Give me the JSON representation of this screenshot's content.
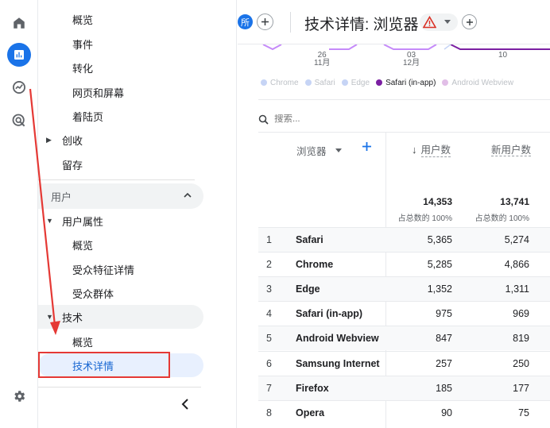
{
  "rail": {
    "items": [
      {
        "icon": "home-icon"
      },
      {
        "icon": "reports-icon",
        "active": true
      },
      {
        "icon": "explore-icon"
      },
      {
        "icon": "advertising-icon"
      }
    ],
    "settings_icon": "gear-icon"
  },
  "sidebar": {
    "top_items": [
      "概览",
      "事件",
      "转化",
      "网页和屏幕",
      "着陆页"
    ],
    "monetization": "创收",
    "retention": "留存",
    "section_user": "用户",
    "user_attributes": "用户属性",
    "user_attr_items": [
      "概览",
      "受众特征详情",
      "受众群体"
    ],
    "tech": "技术",
    "tech_items": [
      "概览",
      "技术详情"
    ],
    "collapse_icon": "chevron-left-icon"
  },
  "header": {
    "badge": "所",
    "title": "技术详情: 浏览器"
  },
  "chart": {
    "x_ticks": [
      {
        "day": "26",
        "month": "11月"
      },
      {
        "day": "03",
        "month": "12月"
      },
      {
        "day": "10",
        "month": ""
      }
    ],
    "legend": [
      {
        "label": "Chrome",
        "color": "#c6d4f5"
      },
      {
        "label": "Safari",
        "color": "#c6d4f5"
      },
      {
        "label": "Edge",
        "color": "#c6d4f5"
      },
      {
        "label": "Safari (in-app)",
        "color": "#7b1fa2"
      },
      {
        "label": "Android Webview",
        "color": "#e1bee7"
      }
    ]
  },
  "search": {
    "placeholder": "搜索..."
  },
  "table": {
    "dimension_header": "浏览器",
    "col_users": "用户数",
    "col_new_users": "新用户数",
    "total_users": "14,353",
    "total_new_users": "13,741",
    "total_users_pct": "占总数的 100%",
    "total_new_pct": "占总数的 100%",
    "rows": [
      {
        "rank": "1",
        "name": "Safari",
        "users": "5,365",
        "new_users": "5,274"
      },
      {
        "rank": "2",
        "name": "Chrome",
        "users": "5,285",
        "new_users": "4,866"
      },
      {
        "rank": "3",
        "name": "Edge",
        "users": "1,352",
        "new_users": "1,311"
      },
      {
        "rank": "4",
        "name": "Safari (in-app)",
        "users": "975",
        "new_users": "969"
      },
      {
        "rank": "5",
        "name": "Android Webview",
        "users": "847",
        "new_users": "819"
      },
      {
        "rank": "6",
        "name": "Samsung Internet",
        "users": "257",
        "new_users": "250"
      },
      {
        "rank": "7",
        "name": "Firefox",
        "users": "185",
        "new_users": "177"
      },
      {
        "rank": "8",
        "name": "Opera",
        "users": "90",
        "new_users": "75"
      }
    ]
  },
  "colors": {
    "accent": "#1a73e8",
    "annotation": "#e53935",
    "warning": "#e37400"
  }
}
